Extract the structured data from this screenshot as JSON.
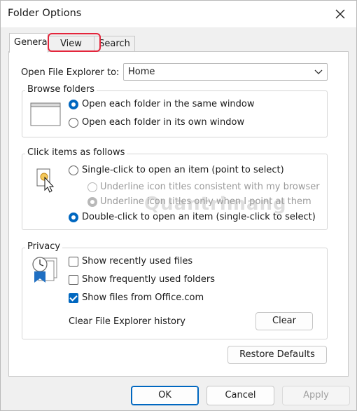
{
  "window": {
    "title": "Folder Options"
  },
  "tabs": [
    {
      "label": "General"
    },
    {
      "label": "View"
    },
    {
      "label": "Search"
    }
  ],
  "open_explorer": {
    "label": "Open File Explorer to:",
    "value": "Home"
  },
  "browse": {
    "title": "Browse folders",
    "options": [
      {
        "label": "Open each folder in the same window",
        "selected": true
      },
      {
        "label": "Open each folder in its own window",
        "selected": false
      }
    ]
  },
  "click": {
    "title": "Click items as follows",
    "single": "Single-click to open an item (point to select)",
    "underline_browser": "Underline icon titles consistent with my browser",
    "underline_point": "Underline icon titles only when I point at them",
    "double": "Double-click to open an item (single-click to select)"
  },
  "privacy": {
    "title": "Privacy",
    "checks": [
      {
        "label": "Show recently used files",
        "checked": false
      },
      {
        "label": "Show frequently used folders",
        "checked": false
      },
      {
        "label": "Show files from Office.com",
        "checked": true
      }
    ],
    "clear_label": "Clear File Explorer history",
    "clear_button": "Clear"
  },
  "restore_button": "Restore Defaults",
  "footer": {
    "ok": "OK",
    "cancel": "Cancel",
    "apply": "Apply"
  },
  "watermark": "Quantrimang",
  "colors": {
    "accent": "#0067c0",
    "highlight": "#e4253b"
  }
}
